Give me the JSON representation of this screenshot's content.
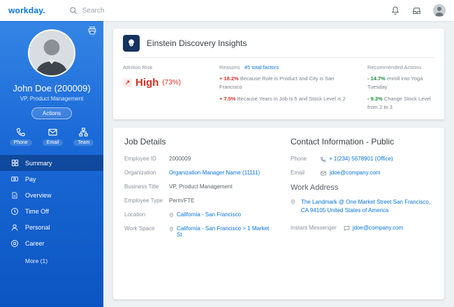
{
  "topbar": {
    "logo": "workday.",
    "search_placeholder": "Search"
  },
  "sidebar": {
    "name": "John Doe (200009)",
    "title": "VP, Product Management",
    "actions_label": "Actions",
    "quick_actions": [
      {
        "label": "Phone"
      },
      {
        "label": "Email"
      },
      {
        "label": "Team"
      }
    ],
    "nav": [
      {
        "label": "Summary"
      },
      {
        "label": "Pay"
      },
      {
        "label": "Overview"
      },
      {
        "label": "Time Off"
      },
      {
        "label": "Personal"
      },
      {
        "label": "Career"
      }
    ],
    "more_label": "More (1)"
  },
  "insights": {
    "title": "Einstein Discovery Insights",
    "attrition": {
      "label": "Attrition Risk",
      "arrow_glyph": "↗",
      "value": "High",
      "percent": "(73%)"
    },
    "reasons": {
      "label": "Reasons",
      "link": "45 total factors",
      "items": [
        {
          "delta": "+ 18.2%",
          "text": "Because Role is Product and City is San Francisco"
        },
        {
          "delta": "+ 7.5%",
          "text": "Because Years in Job is 5 and Stock Level is 2"
        }
      ]
    },
    "recommended": {
      "label": "Recommended Actions",
      "items": [
        {
          "delta": "- 14.7%",
          "text": "enroll into Yoga Tuesday"
        },
        {
          "delta": "- 9.3%",
          "text": "Change Stock Level from 2 to 3"
        }
      ]
    }
  },
  "job_details": {
    "title": "Job Details",
    "rows": [
      {
        "label": "Employee ID",
        "value": "2000009"
      },
      {
        "label": "Organization",
        "value": "Organization Manager Name (11111)"
      },
      {
        "label": "Business Title",
        "value": "VP, Product Management"
      },
      {
        "label": "Employee Type",
        "value": "Perm/FTE"
      },
      {
        "label": "Location",
        "value": "California - San Francisco"
      },
      {
        "label": "Work Space",
        "value": "California - San Francisco > 1 Market St"
      }
    ]
  },
  "contact": {
    "title": "Contact Information - Public",
    "phone_label": "Phone",
    "phone_value": "+ 1(234) 5678901 (Office)",
    "email_label": "Email",
    "email_value": "jdoe@company.com",
    "work_address_title": "Work Address",
    "work_address": "The Landmark @ One Market Street San Francisco, CA 94105 United States of America",
    "im_label": "Instant Messenger",
    "im_value": "jdoe@company.com"
  }
}
